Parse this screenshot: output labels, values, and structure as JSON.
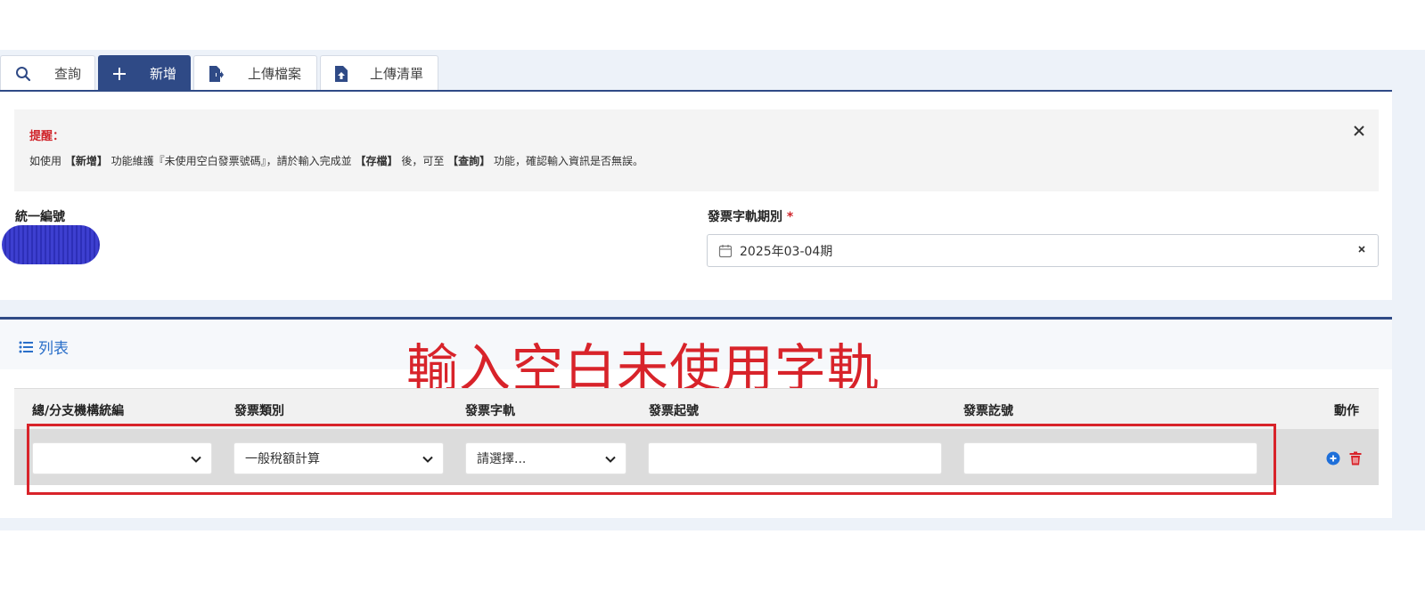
{
  "tabs": [
    {
      "label": "查詢",
      "icon": "search-icon"
    },
    {
      "label": "新增",
      "icon": "plus-icon",
      "active": true
    },
    {
      "label": "上傳檔案",
      "icon": "file-export-icon"
    },
    {
      "label": "上傳清單",
      "icon": "file-upload-icon"
    }
  ],
  "alert": {
    "title": "提醒：",
    "msg_1": "如使用 ",
    "msg_2": "【新增】",
    "msg_3": " 功能維護『未使用空白發票號碼』，請於輸入完成並 ",
    "msg_4": "【存檔】",
    "msg_5": " 後，可至 ",
    "msg_6": "【查詢】",
    "msg_7": " 功能，確認輸入資訊是否無誤。"
  },
  "form": {
    "tax_id_label": "統一編號",
    "period_label": "發票字軌期別",
    "required_mark": "*",
    "period_value": "2025年03-04期"
  },
  "list": {
    "title": "列表",
    "annotation": "輸入空白未使用字軌",
    "columns": [
      "總/分支機構統編",
      "發票類別",
      "發票字軌",
      "發票起號",
      "發票訖號",
      "動作"
    ],
    "row": {
      "branch_value": "",
      "category_value": "一般稅額計算",
      "track_value": "請選擇...",
      "start_no": "",
      "end_no": ""
    }
  },
  "colors": {
    "primary": "#2f4a86",
    "link": "#2a6fc9",
    "danger": "#d8232a",
    "add_icon": "#1e6fd9"
  }
}
